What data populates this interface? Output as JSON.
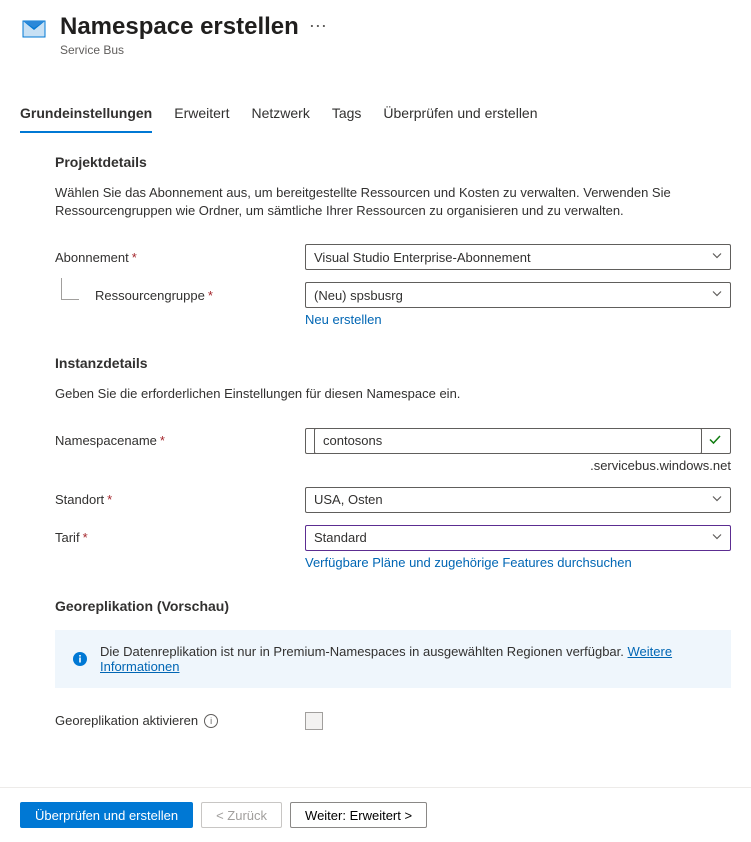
{
  "header": {
    "title": "Namespace erstellen",
    "subtitle": "Service Bus"
  },
  "tabs": {
    "basics": "Grundeinstellungen",
    "advanced": "Erweitert",
    "networking": "Netzwerk",
    "tags": "Tags",
    "review": "Überprüfen und erstellen"
  },
  "projectDetails": {
    "heading": "Projektdetails",
    "description": "Wählen Sie das Abonnement aus, um bereitgestellte Ressourcen und Kosten zu verwalten. Verwenden Sie Ressourcengruppen wie Ordner, um sämtliche Ihrer Ressourcen zu organisieren und zu verwalten.",
    "subscriptionLabel": "Abonnement",
    "subscriptionValue": "Visual Studio Enterprise-Abonnement",
    "resourceGroupLabel": "Ressourcengruppe",
    "resourceGroupValue": "(Neu) spsbusrg",
    "createNewLink": "Neu erstellen"
  },
  "instanceDetails": {
    "heading": "Instanzdetails",
    "description": "Geben Sie die erforderlichen Einstellungen für diesen Namespace ein.",
    "nameLabel": "Namespacename",
    "nameValue": "contosons",
    "nameSuffix": ".servicebus.windows.net",
    "locationLabel": "Standort",
    "locationValue": "USA, Osten",
    "tierLabel": "Tarif",
    "tierValue": "Standard",
    "browsePlansLink": "Verfügbare Pläne und zugehörige Features durchsuchen"
  },
  "geoReplication": {
    "heading": "Georeplikation (Vorschau)",
    "infoText": "Die Datenreplikation ist nur in Premium-Namespaces in ausgewählten Regionen verfügbar. ",
    "infoLink": "Weitere Informationen",
    "enableLabel": "Georeplikation aktivieren"
  },
  "footer": {
    "review": "Überprüfen und erstellen",
    "back": "<  Zurück",
    "next": "Weiter: Erweitert  >"
  }
}
